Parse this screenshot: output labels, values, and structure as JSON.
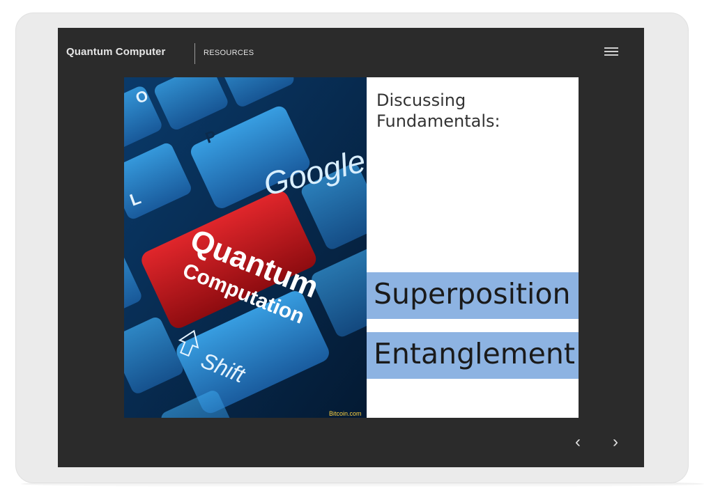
{
  "header": {
    "title": "Quantum Computer",
    "section": "RESOURCES"
  },
  "slide": {
    "heading_line1": "Discussing",
    "heading_line2": "Fundamentals:",
    "bands": [
      "Superposition",
      "Entanglement"
    ],
    "band_color": "#8db3e2"
  },
  "image_text": {
    "key_main_line1": "Quantum",
    "key_main_line2": "Computation",
    "key_google": "Google",
    "key_shift": "Shift",
    "key_o": "O",
    "key_p": "P",
    "key_l": "L",
    "credit": "Bitcoin.com"
  },
  "navigation": {
    "prev": "‹",
    "next": "›"
  },
  "colors": {
    "screen_bg": "#2b2b2b",
    "key_blue": "#2f8fd6",
    "key_red": "#c8141a"
  },
  "icons": {
    "menu": "hamburger-menu-icon",
    "prev": "chevron-left-icon",
    "next": "chevron-right-icon"
  }
}
